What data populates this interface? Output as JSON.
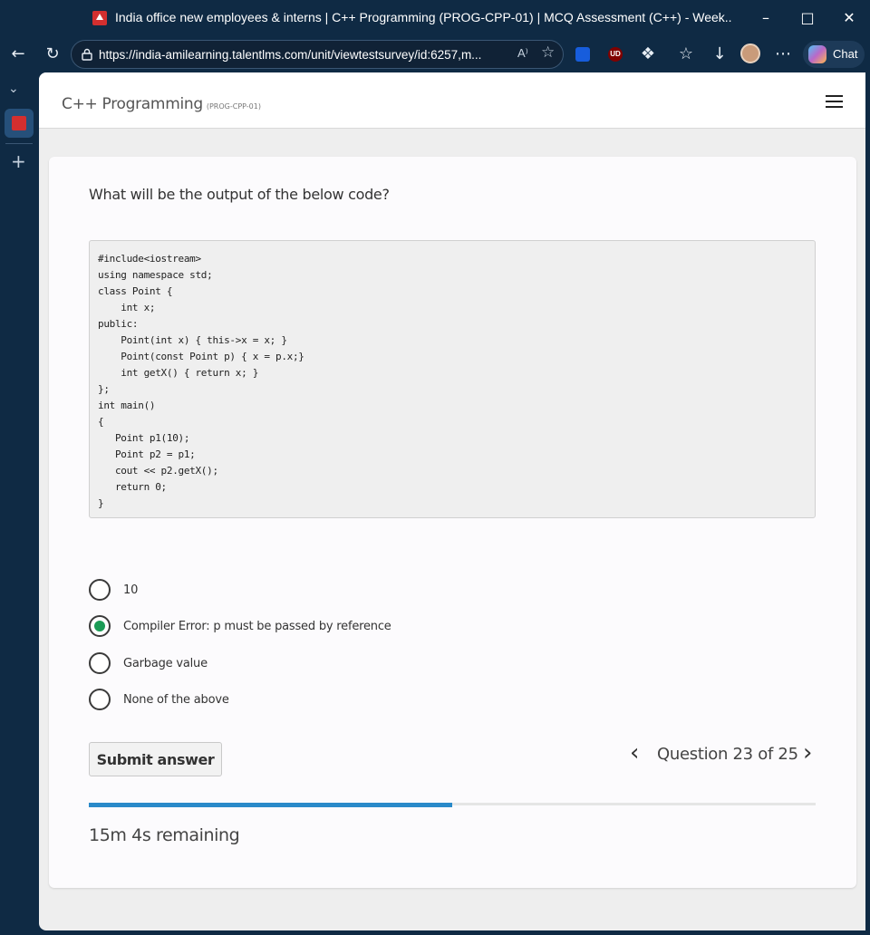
{
  "browser": {
    "window_title": "India office new employees & interns | C++ Programming (PROG-CPP-01) | MCQ Assessment (C++) - Week...",
    "url": "https://india-amilearning.talentlms.com/unit/viewtestsurvey/id:6257,m...",
    "read_aloud_label": "A⁾",
    "chat_label": "Chat",
    "extensions": [
      {
        "name": "bitwarden",
        "color": "#175ddc"
      },
      {
        "name": "ublock",
        "color": "#800000",
        "text": "UD"
      }
    ]
  },
  "page": {
    "course_title": "C++ Programming",
    "course_code": "(PROG-CPP-01)",
    "question": "What will be the output of the below code?",
    "code": "#include<iostream>\nusing namespace std;\nclass Point {\n    int x;\npublic:\n    Point(int x) { this->x = x; }\n    Point(const Point p) { x = p.x;}\n    int getX() { return x; }\n};\nint main()\n{\n   Point p1(10);\n   Point p2 = p1;\n   cout << p2.getX();\n   return 0;\n}",
    "options": [
      {
        "label": "10",
        "selected": false
      },
      {
        "label": "Compiler Error: p must be passed by reference",
        "selected": true
      },
      {
        "label": "Garbage value",
        "selected": false
      },
      {
        "label": "None of the above",
        "selected": false
      }
    ],
    "submit_label": "Submit answer",
    "pager_text": "Question 23 of 25",
    "progress_fraction": 0.5,
    "remaining": "15m 4s remaining"
  },
  "colors": {
    "accent_progress": "#2a8ac9",
    "selected_radio": "#1a9b55",
    "chrome_bg": "#0f2a44"
  }
}
